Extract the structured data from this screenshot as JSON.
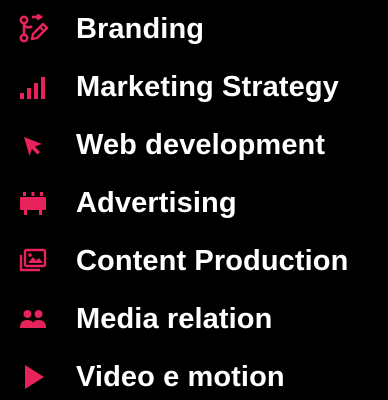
{
  "accent_color": "#e8225a",
  "text_color": "#ffffff",
  "background_color": "#000000",
  "services": [
    {
      "label": "Branding",
      "icon": "branding-pen-icon"
    },
    {
      "label": "Marketing Strategy",
      "icon": "bar-chart-icon"
    },
    {
      "label": "Web development",
      "icon": "cursor-arrow-icon"
    },
    {
      "label": "Advertising",
      "icon": "billboard-icon"
    },
    {
      "label": "Content Production",
      "icon": "image-gallery-icon"
    },
    {
      "label": "Media relation",
      "icon": "people-icon"
    },
    {
      "label": "Video e motion",
      "icon": "play-icon"
    }
  ]
}
